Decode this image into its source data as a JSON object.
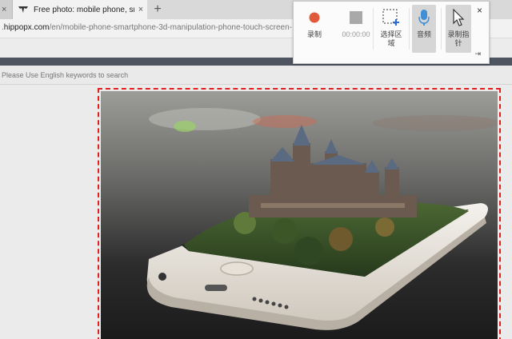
{
  "browser": {
    "prev_tab": {
      "close_symbol": "×"
    },
    "active_tab": {
      "title": "Free photo: mobile phone, smar",
      "close_symbol": "×"
    },
    "new_tab_symbol": "+",
    "address": {
      "domain": "hippopx.com",
      "prefix": ".",
      "path": "/en/mobile-phone-smartphone-3d-manipulation-phone-touch-screen-"
    }
  },
  "page": {
    "search": {
      "placeholder": "Please Use English keywords to search"
    },
    "photo": {
      "description_icon": "photo"
    }
  },
  "recorder": {
    "record_label": "录制",
    "stop_label": "00:00:00",
    "select_region_label": "选择区\n域",
    "audio_label": "音频",
    "record_cursor_label": "录制指\n针",
    "close_symbol": "×",
    "pin_symbol": "⇥",
    "colors": {
      "record": "#e05a3a",
      "stop": "#a9a9a9",
      "mic": "#3f8ed6"
    }
  }
}
